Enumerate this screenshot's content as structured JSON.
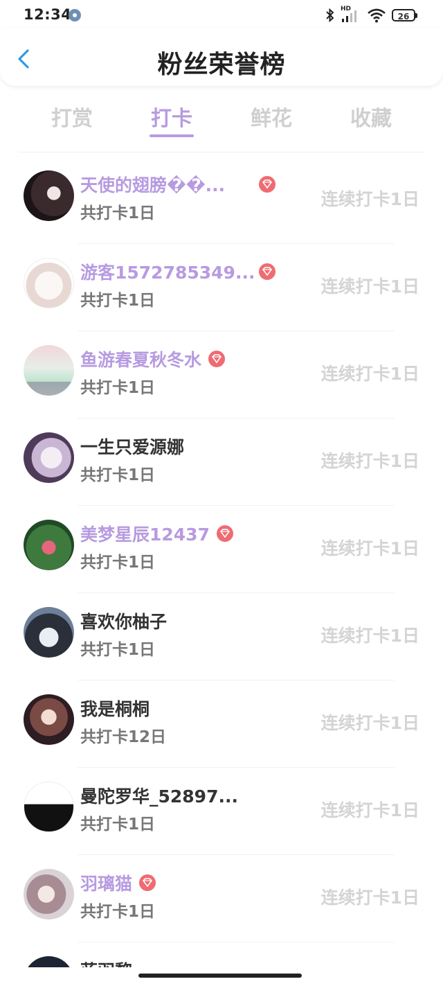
{
  "status_bar": {
    "time": "12:34",
    "network_label": "HD",
    "battery": "26",
    "icons": [
      "settings-gear-icon",
      "bluetooth-icon",
      "signal-icon",
      "wifi-icon",
      "battery-icon"
    ]
  },
  "header": {
    "title": "粉丝荣誉榜",
    "back_icon": "chevron-left-icon",
    "accent_color": "#2f9be6"
  },
  "tabs": [
    {
      "label": "打赏",
      "active": false
    },
    {
      "label": "打卡",
      "active": true
    },
    {
      "label": "鲜花",
      "active": false
    },
    {
      "label": "收藏",
      "active": false
    }
  ],
  "colors": {
    "vip_name": "#b79be0",
    "plain_name": "#333333",
    "vip_badge": "#ef6b72",
    "streak_text": "#d4d4d4",
    "active_tab": "#b79be0"
  },
  "fans": [
    {
      "name": "天使的翅膀��...",
      "vip": true,
      "total": "共打卡1日",
      "streak": "连续打卡1日"
    },
    {
      "name": "游客1572785349...",
      "vip": true,
      "total": "共打卡1日",
      "streak": "连续打卡1日"
    },
    {
      "name": "鱼游春夏秋冬水",
      "vip": true,
      "total": "共打卡1日",
      "streak": "连续打卡1日"
    },
    {
      "name": "一生只爱源娜",
      "vip": false,
      "total": "共打卡1日",
      "streak": "连续打卡1日"
    },
    {
      "name": "美梦星辰12437",
      "vip": true,
      "total": "共打卡1日",
      "streak": "连续打卡1日"
    },
    {
      "name": "喜欢你柚子",
      "vip": false,
      "total": "共打卡1日",
      "streak": "连续打卡1日"
    },
    {
      "name": "我是桐桐",
      "vip": false,
      "total": "共打卡12日",
      "streak": "连续打卡1日"
    },
    {
      "name": "曼陀罗华_52897...",
      "vip": false,
      "total": "共打卡1日",
      "streak": "连续打卡1日"
    },
    {
      "name": "羽璃猫",
      "vip": true,
      "total": "共打卡1日",
      "streak": "连续打卡1日"
    },
    {
      "name": "蓝羽黎",
      "vip": false,
      "total": "",
      "streak": ""
    }
  ]
}
